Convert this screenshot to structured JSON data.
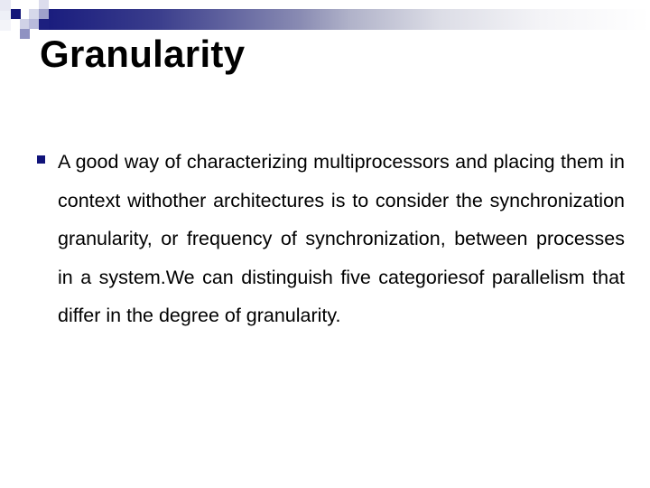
{
  "slide": {
    "title": "Granularity",
    "accent_color": "#14177a",
    "bullets": [
      {
        "icon": "square-bullet-icon",
        "text": "A good way of characterizing multiprocessors and placing them in context withother architectures is to consider the synchronization granularity, or frequency of synchronization, between processes in a system.We can distinguish five categoriesof parallelism that differ in the degree of granularity."
      }
    ]
  }
}
